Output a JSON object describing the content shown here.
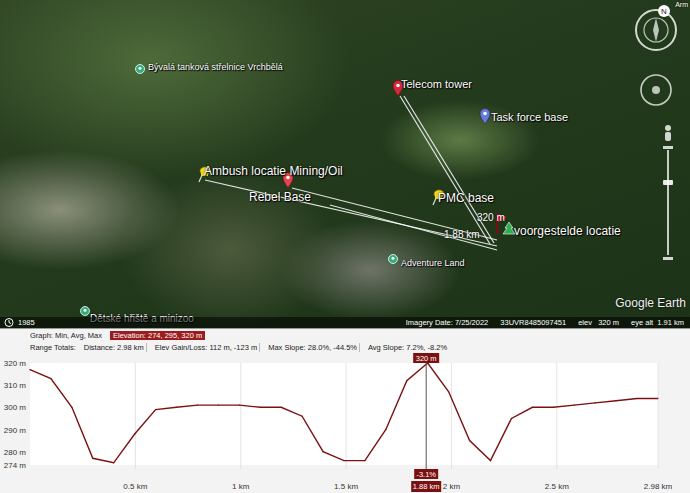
{
  "map": {
    "imagery": "satellite",
    "corner_label": "Arm",
    "compass": {
      "north": "N"
    },
    "attribution": "Google Earth",
    "markers": [
      {
        "label": "Bývalá tanková střelnice Vrchbělá",
        "kind": "place",
        "color": "#2fae7c"
      },
      {
        "label": "Telecom tower",
        "kind": "balloon",
        "color": "#d9263a"
      },
      {
        "label": "Task force base",
        "kind": "balloon",
        "color": "#5b7fe0"
      },
      {
        "label": "Ambush locatie Mining/Oil",
        "kind": "pushpin",
        "color": "#f2d81c"
      },
      {
        "label": "Rebel Base",
        "kind": "balloon",
        "color": "#e2434f"
      },
      {
        "label": "PMC base",
        "kind": "pushpin",
        "color": "#f2d81c"
      },
      {
        "label": "voorgestelde locatie",
        "kind": "proposal",
        "color": "#e0202c"
      },
      {
        "label": "Adventure Land",
        "kind": "place",
        "color": "#2fae7c"
      },
      {
        "label": "Dětské hřiště a minizoo",
        "kind": "place",
        "color": "#2fae7c"
      }
    ],
    "measure": {
      "elevation": "320 m",
      "distance": "1.88 km"
    }
  },
  "status_bar": {
    "year": "1985",
    "imagery_date": "Imagery Date: 7/25/2022",
    "coords": "33UVR8485097451",
    "elev": "elev   320 m",
    "eye_alt": "eye alt  1.91 km"
  },
  "profile": {
    "graph_label": "Graph: Min, Avg, Max",
    "elevation": "Elevation: 274, 295, 320 m",
    "range_label": "Range Totals:",
    "distance": "Distance: 2.98 km",
    "gain": "Elev Gain/Loss: 112 m, -123 m",
    "max_slope": "Max Slope: 28.0%, -44.5%",
    "avg_slope": "Avg Slope: 7.2%, -8.2%",
    "y_ticks": [
      {
        "label": "320 m",
        "value": 320
      },
      {
        "label": "310 m",
        "value": 310
      },
      {
        "label": "300 m",
        "value": 300
      },
      {
        "label": "290 m",
        "value": 290
      },
      {
        "label": "280 m",
        "value": 280
      },
      {
        "label": "274 m",
        "value": 274
      }
    ],
    "x_ticks": [
      {
        "label": "0.5 km",
        "value": 0.5
      },
      {
        "label": "1 km",
        "value": 1
      },
      {
        "label": "1.5 km",
        "value": 1.5
      },
      {
        "label": "2 km",
        "value": 2
      },
      {
        "label": "2.5 km",
        "value": 2.5
      },
      {
        "label": "2.98 km",
        "value": 2.98
      }
    ],
    "x_max": 2.98,
    "y_min": 274,
    "y_max": 320,
    "series": [
      317,
      313,
      300,
      277,
      275,
      288,
      299,
      300,
      301,
      301,
      301,
      300,
      300,
      296,
      280,
      276,
      276,
      290,
      312,
      320,
      307,
      285,
      276,
      295,
      300,
      300,
      301,
      302,
      303,
      304,
      304
    ],
    "cursor": {
      "position": 1.88,
      "elevation": "320 m",
      "slope": "-3.1%",
      "distance": "1.88 km"
    }
  }
}
